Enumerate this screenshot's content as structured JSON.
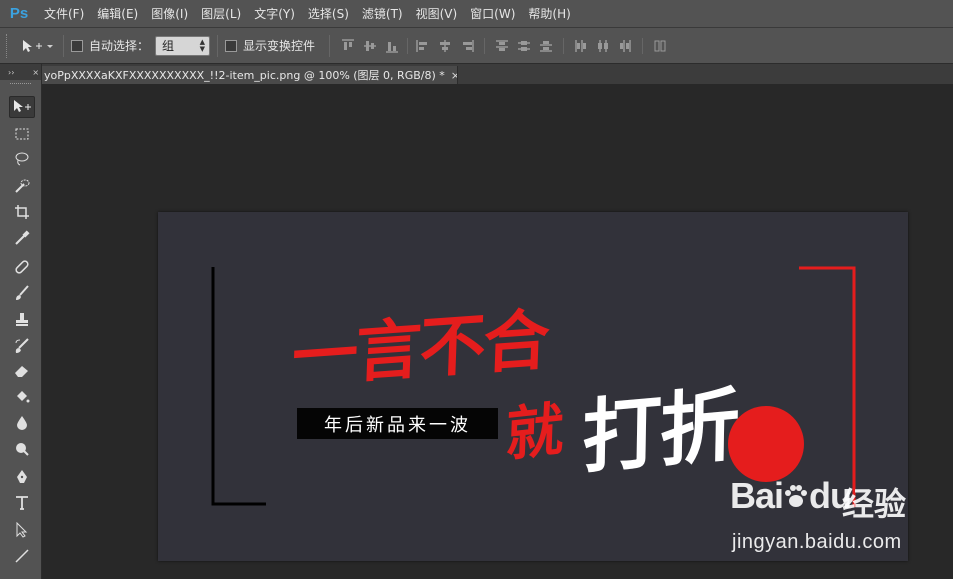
{
  "app": {
    "logo": "Ps",
    "menu": [
      "文件(F)",
      "编辑(E)",
      "图像(I)",
      "图层(L)",
      "文字(Y)",
      "选择(S)",
      "滤镜(T)",
      "视图(V)",
      "窗口(W)",
      "帮助(H)"
    ]
  },
  "options": {
    "auto_select_label": "自动选择：",
    "auto_select_value": "组",
    "show_transform_label": "显示变换控件"
  },
  "document": {
    "tab_title": "yoPpXXXXaKXFXXXXXXXXXX_!!2-item_pic.png @ 100% (图层 0, RGB/8) *",
    "tab_close": "×",
    "toolbar_header": "››",
    "toolbar_header_close": "×"
  },
  "artwork": {
    "headline_red": "一言不合",
    "headline_jiu": "就",
    "headline_white": "打折",
    "slogan": "年后新品来一波",
    "background_color": "#32323a",
    "accent_color": "#e51d1d"
  },
  "watermark": {
    "brand": "Bai",
    "brand_suffix": "du",
    "cn": "经验",
    "url": "jingyan.baidu.com"
  },
  "tools": [
    "move-tool-icon",
    "marquee-tool-icon",
    "lasso-tool-icon",
    "quick-select-tool-icon",
    "crop-tool-icon",
    "eyedropper-tool-icon",
    "healing-brush-tool-icon",
    "brush-tool-icon",
    "clone-stamp-tool-icon",
    "history-brush-tool-icon",
    "eraser-tool-icon",
    "paint-bucket-tool-icon",
    "blur-tool-icon",
    "dodge-tool-icon",
    "pen-tool-icon",
    "type-tool-icon",
    "path-select-tool-icon",
    "line-tool-icon"
  ]
}
